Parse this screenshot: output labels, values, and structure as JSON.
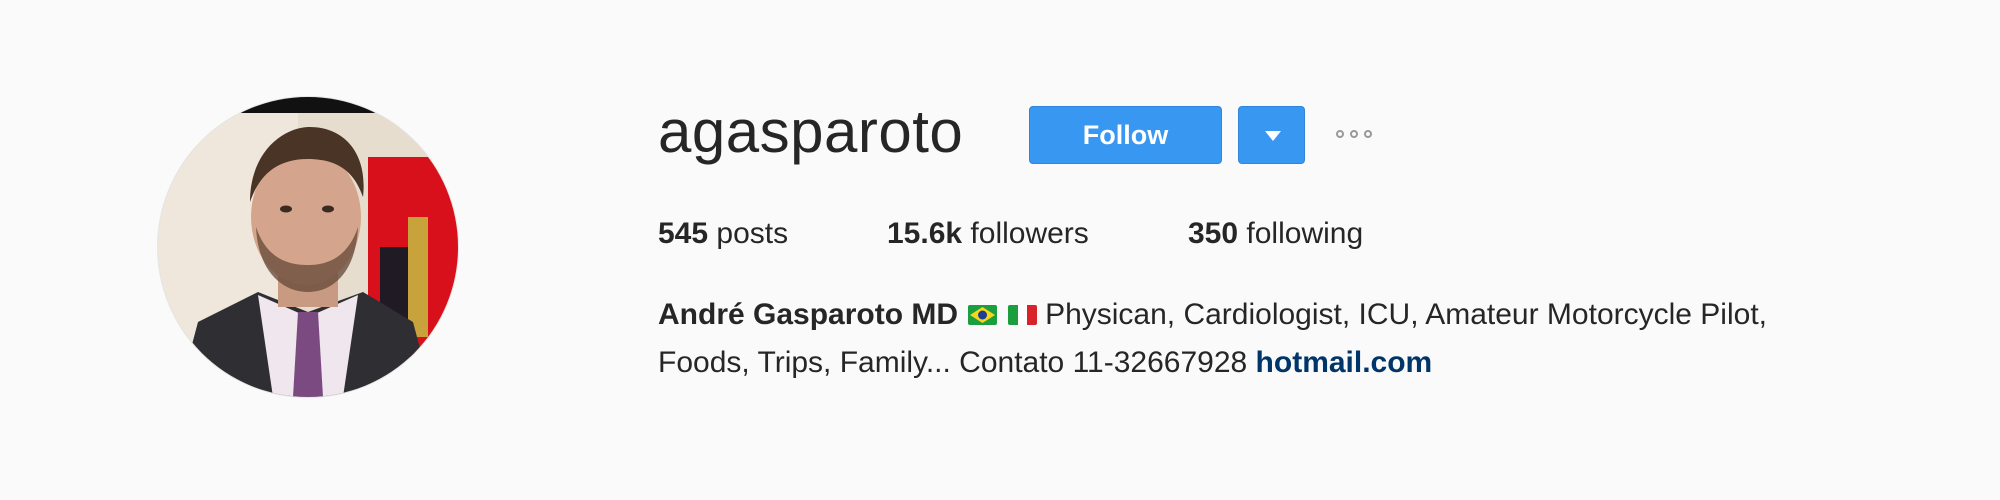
{
  "profile": {
    "username": "agasparoto",
    "follow_label": "Follow",
    "dropdown_icon": "caret-down-icon",
    "more_icon": "ellipsis-icon",
    "stats": {
      "posts_count": "545",
      "posts_label": "posts",
      "followers_count": "15.6k",
      "followers_label": "followers",
      "following_count": "350",
      "following_label": "following"
    },
    "bio": {
      "name": "André Gasparoto MD",
      "flags": [
        "brazil-flag-icon",
        "italy-flag-icon"
      ],
      "text_line_1": "Physican, Cardiologist, ICU, Amateur Motorcycle Pilot,",
      "text_line_2": "Foods, Trips, Family... Contato 11-32667928",
      "link": "hotmail.com"
    },
    "colors": {
      "follow_button": "#3897f0",
      "link": "#003569",
      "background": "#fafafa"
    }
  }
}
